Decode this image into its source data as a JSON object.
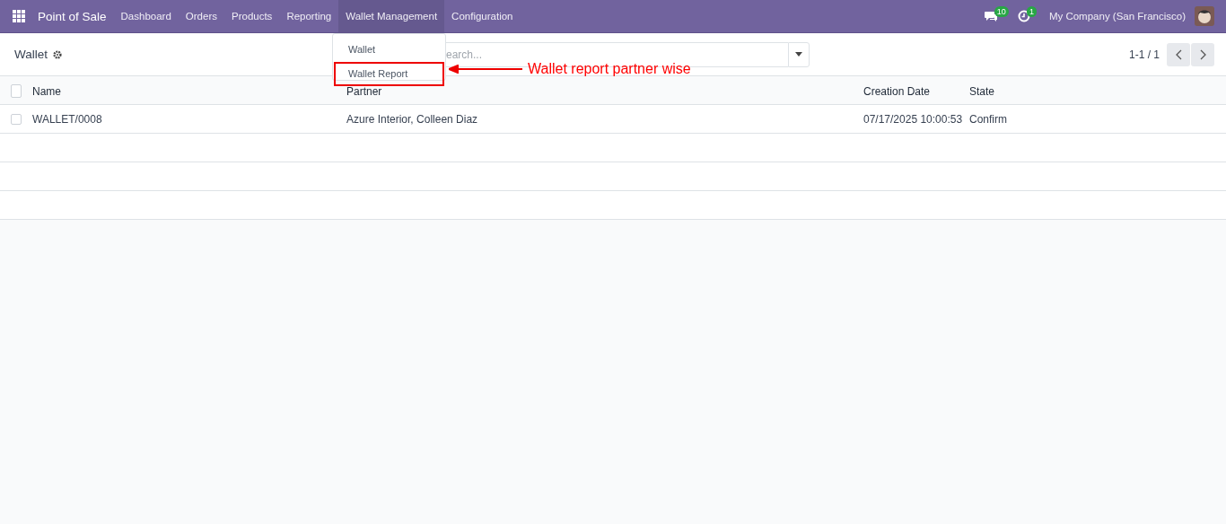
{
  "navbar": {
    "app_name": "Point of Sale",
    "menu": [
      {
        "label": "Dashboard",
        "selected": false
      },
      {
        "label": "Orders",
        "selected": false
      },
      {
        "label": "Products",
        "selected": false
      },
      {
        "label": "Reporting",
        "selected": false
      },
      {
        "label": "Wallet Management",
        "selected": true
      },
      {
        "label": "Configuration",
        "selected": false
      }
    ],
    "messages_badge": "10",
    "activities_badge": "1",
    "company": "My Company (San Francisco)"
  },
  "control_panel": {
    "title": "Wallet",
    "search": {
      "placeholder": "earch..."
    },
    "pager": "1-1 / 1"
  },
  "dropdown": {
    "items": [
      {
        "label": "Wallet",
        "highlighted": false
      },
      {
        "label": "Wallet Report",
        "highlighted": true
      }
    ]
  },
  "annotation": {
    "text": "Wallet report partner wise"
  },
  "table": {
    "columns": [
      "Name",
      "Partner",
      "Creation Date",
      "State"
    ],
    "rows": [
      {
        "checked": false,
        "cells": [
          "WALLET/0008",
          "Azure Interior, Colleen Diaz",
          "07/17/2025 10:00:53",
          "Confirm"
        ]
      }
    ],
    "header_checked": false
  }
}
